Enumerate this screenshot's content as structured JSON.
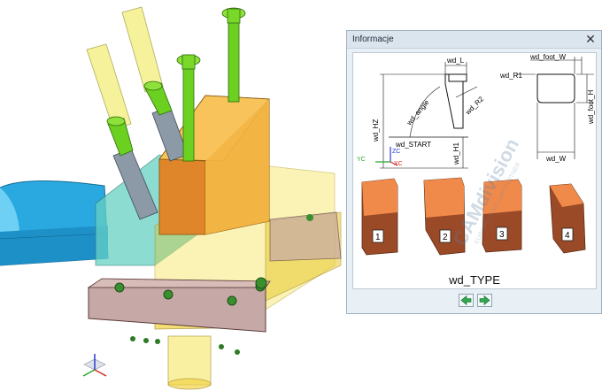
{
  "dialog": {
    "title": "Informacje",
    "close_glyph": "✕",
    "type_label": "wd_TYPE",
    "prev_icon": "arrow-left-icon",
    "next_icon": "arrow-right-icon"
  },
  "diagram": {
    "labels": {
      "wd_L": "wd_L",
      "wd_foot_W": "wd_foot_W",
      "wd_R1": "wd_R1",
      "wd_angle": "wd_angle",
      "wd_R2": "wd_R2",
      "wd_HZ": "wd_HZ",
      "wd_foot_H": "wd_foot_H",
      "wd_START": "wd_START",
      "wd_H1": "wd_H1",
      "wd_W": "wd_W",
      "ZC": "ZC",
      "YC": "YC",
      "XC": "XC"
    },
    "jaw_numbers": [
      "1",
      "2",
      "3",
      "4"
    ],
    "watermark": {
      "brand": "CAMdivision",
      "tagline": "EUROPEAN NX CAM PARTNER"
    }
  },
  "colors": {
    "accent_green": "#2fa84f",
    "copper_top": "#f08a4b",
    "copper_side": "#9b4a27",
    "fixture_yellow": "#f2d84a",
    "fixture_orange": "#f0a030",
    "part_cyan": "#3fb0e0"
  }
}
